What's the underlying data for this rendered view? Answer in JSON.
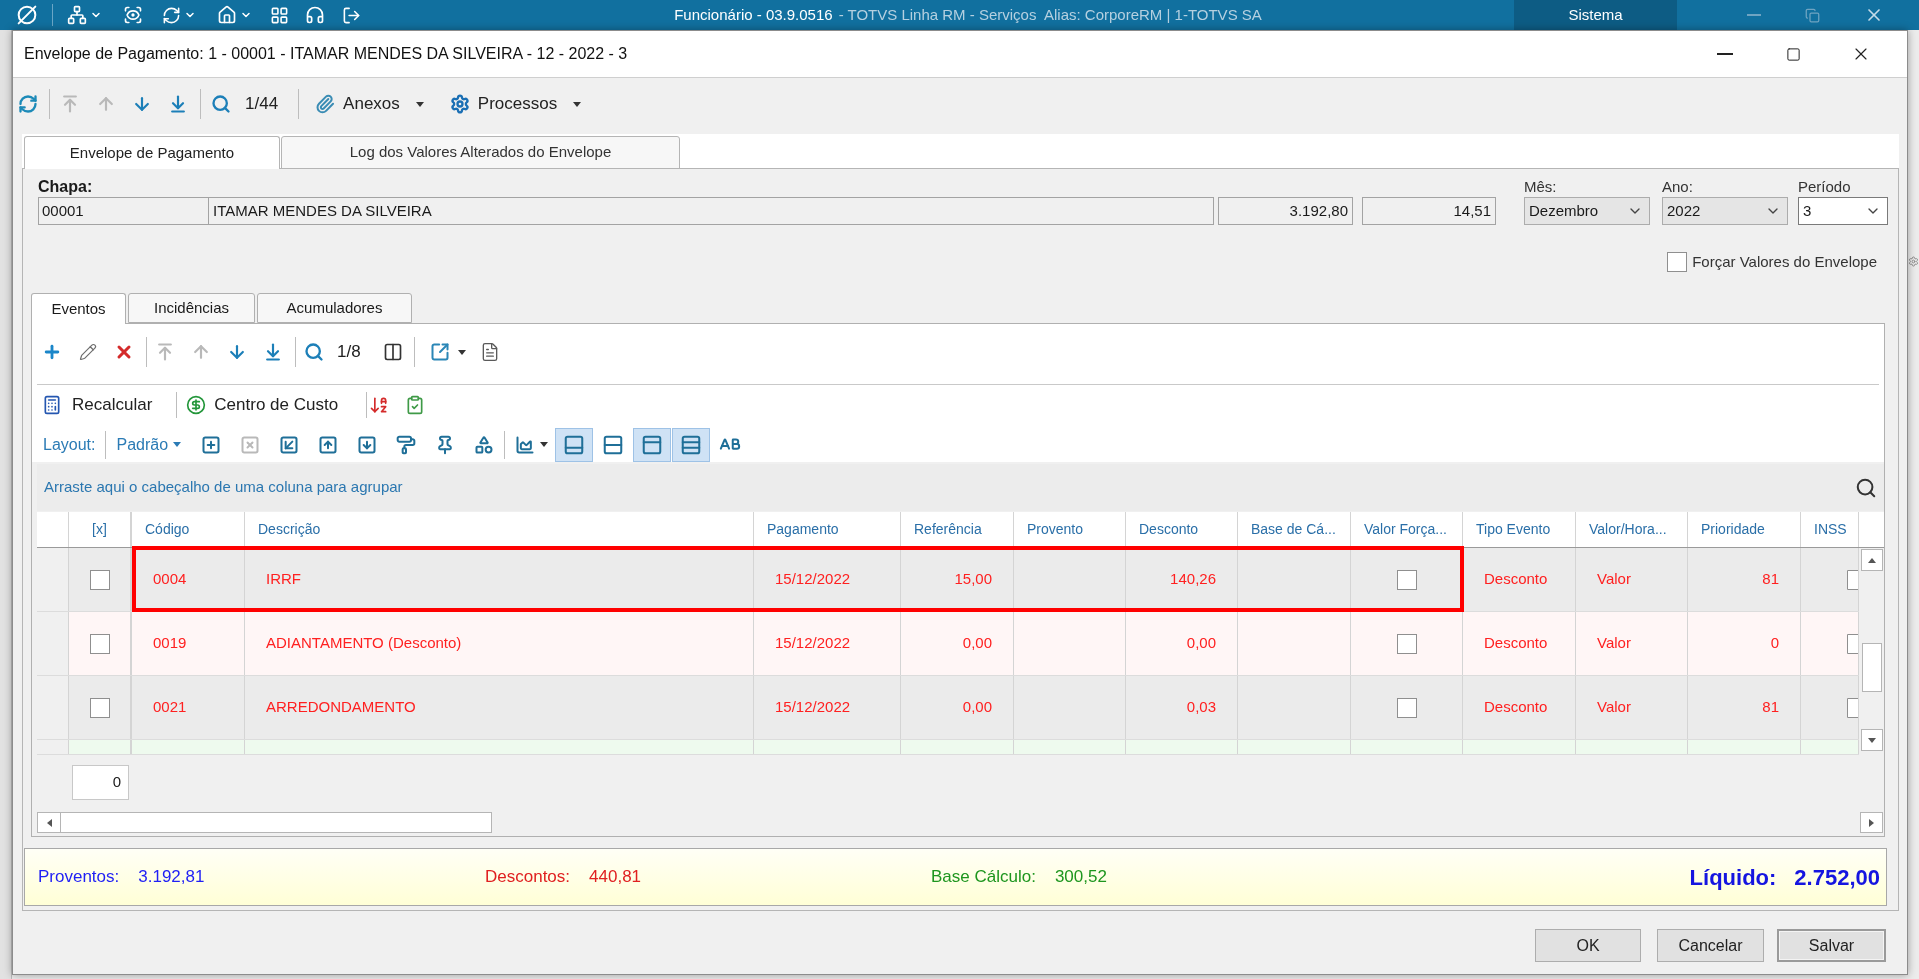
{
  "app_bar": {
    "title": "Funcionário - 03.9.0516",
    "subtitle": "- TOTVS Linha RM - Serviços  Alias: CorporeRM | 1-TOTVS SA",
    "module": "Sistema"
  },
  "window": {
    "title": "Envelope de Pagamento: 1 - 00001 - ITAMAR MENDES DA SILVEIRA - 12 - 2022 - 3"
  },
  "toolbar": {
    "groups": [
      [
        {
          "kind": "refresh",
          "disabled": false
        }
      ],
      [
        {
          "kind": "first",
          "disabled": true
        },
        {
          "kind": "previous",
          "disabled": true
        },
        {
          "kind": "next",
          "disabled": false
        },
        {
          "kind": "last",
          "disabled": false
        }
      ],
      [
        {
          "kind": "search",
          "disabled": false
        },
        {
          "kind": "counter",
          "label": "1/44",
          "disabled": false
        }
      ],
      [
        {
          "kind": "attachments",
          "label": "Anexos",
          "disabled": false
        },
        {
          "kind": "processes",
          "label": "Processos",
          "disabled": false
        }
      ]
    ]
  },
  "tabs": [
    {
      "label": "Envelope de Pagamento",
      "selected": true
    },
    {
      "label": "Log dos Valores Alterados do Envelope",
      "selected": false
    }
  ],
  "header": {
    "chapa_label": "Chapa:",
    "chapa": "00001",
    "name": "ITAMAR MENDES DA SILVEIRA",
    "value_1": "3.192,80",
    "value_2": "14,51",
    "month": {
      "label": "Mês:",
      "value": "Dezembro"
    },
    "year": {
      "label": "Ano:",
      "value": "2022"
    },
    "period": {
      "label": "Período",
      "value": "3"
    },
    "force": {
      "label": "Forçar Valores do Envelope",
      "checked": false
    }
  },
  "subtabs": [
    {
      "label": "Eventos",
      "selected": true
    },
    {
      "label": "Incidências",
      "selected": false
    },
    {
      "label": "Acumuladores",
      "selected": false
    }
  ],
  "grid_toolbar": {
    "groups": [
      [
        {
          "kind": "add",
          "disabled": false
        },
        {
          "kind": "edit",
          "disabled": false
        },
        {
          "kind": "delete",
          "disabled": false
        }
      ],
      [
        {
          "kind": "first",
          "disabled": true
        },
        {
          "kind": "previous",
          "disabled": true
        },
        {
          "kind": "next",
          "disabled": false
        },
        {
          "kind": "last",
          "disabled": false
        }
      ],
      [
        {
          "kind": "search",
          "disabled": false
        },
        {
          "kind": "counter",
          "label": "1/8",
          "disabled": false
        },
        {
          "kind": "columns",
          "disabled": false
        }
      ],
      [
        {
          "kind": "export",
          "disabled": false
        },
        {
          "kind": "report",
          "disabled": false
        }
      ]
    ]
  },
  "action_toolbar": {
    "groups": [
      [
        {
          "kind": "recalculate",
          "label": "Recalcular",
          "disabled": false
        }
      ],
      [
        {
          "kind": "cost_center",
          "label": "Centro de Custo",
          "disabled": false
        }
      ],
      [
        {
          "kind": "sort",
          "disabled": false
        },
        {
          "kind": "validate",
          "disabled": false
        }
      ]
    ]
  },
  "layout_toolbar": {
    "label": "Layout:",
    "preset": "Padrão",
    "groups": [
      [
        {
          "kind": "add_layout",
          "disabled": false
        },
        {
          "kind": "remove_layout",
          "disabled": true
        },
        {
          "kind": "apply_layout",
          "disabled": false
        },
        {
          "kind": "upload_layout",
          "disabled": false
        },
        {
          "kind": "download_layout",
          "disabled": false
        },
        {
          "kind": "format",
          "disabled": false
        },
        {
          "kind": "pin",
          "disabled": false
        },
        {
          "kind": "shapes",
          "disabled": false
        }
      ],
      [
        {
          "kind": "chart",
          "disabled": false
        }
      ]
    ],
    "toggles": [
      {
        "kind": "footer",
        "on": true
      },
      {
        "kind": "row_lines",
        "on": false
      },
      {
        "kind": "header",
        "on": true
      },
      {
        "kind": "group_panel",
        "on": true
      },
      {
        "kind": "text",
        "on": false
      }
    ]
  },
  "group_panel": {
    "hint": "Arraste aqui o cabeçalho de uma coluna para agrupar"
  },
  "table": {
    "columns": [
      "[x]",
      "Código",
      "Descrição",
      "Pagamento",
      "Referência",
      "Provento",
      "Desconto",
      "Base de Cá...",
      "Valor Força...",
      "Tipo Evento",
      "Valor/Hora...",
      "Prioridade",
      "INSS"
    ],
    "rows": [
      {
        "checked": false,
        "code": "0004",
        "description": "IRRF",
        "payment": "15/12/2022",
        "reference": "15,00",
        "deduction": "140,26",
        "forced_value": false,
        "event_type": "Desconto",
        "value_hour": "Valor",
        "priority": "81",
        "inss": false,
        "outlined": true,
        "color": "#ebebeb"
      },
      {
        "checked": false,
        "code": "0019",
        "description": "ADIANTAMENTO (Desconto)",
        "payment": "15/12/2022",
        "reference": "0,00",
        "deduction": "0,00",
        "forced_value": false,
        "event_type": "Desconto",
        "value_hour": "Valor",
        "priority": "0",
        "inss": false,
        "outlined": false,
        "color": "#fff6f6"
      },
      {
        "checked": false,
        "code": "0021",
        "description": "ARREDONDAMENTO",
        "payment": "15/12/2022",
        "reference": "0,00",
        "deduction": "0,03",
        "forced_value": false,
        "event_type": "Desconto",
        "value_hour": "Valor",
        "priority": "81",
        "inss": false,
        "outlined": false,
        "color": "#ebebeb"
      },
      {
        "color": "#eefaee"
      }
    ],
    "summary": "0"
  },
  "totals": {
    "items": [
      {
        "label": "Proventos:",
        "value": "3.192,81",
        "color": "#1f1ff5"
      },
      {
        "label": "Descontos:",
        "value": "440,81",
        "color": "#e02020"
      },
      {
        "label": "Base Cálculo:",
        "value": "300,52",
        "color": "#1e961e"
      }
    ],
    "net": {
      "label": "Líquido:",
      "value": "2.752,00"
    }
  },
  "buttons": [
    {
      "label": "OK",
      "default": false
    },
    {
      "label": "Cancelar",
      "default": false
    },
    {
      "label": "Salvar",
      "default": true
    }
  ]
}
